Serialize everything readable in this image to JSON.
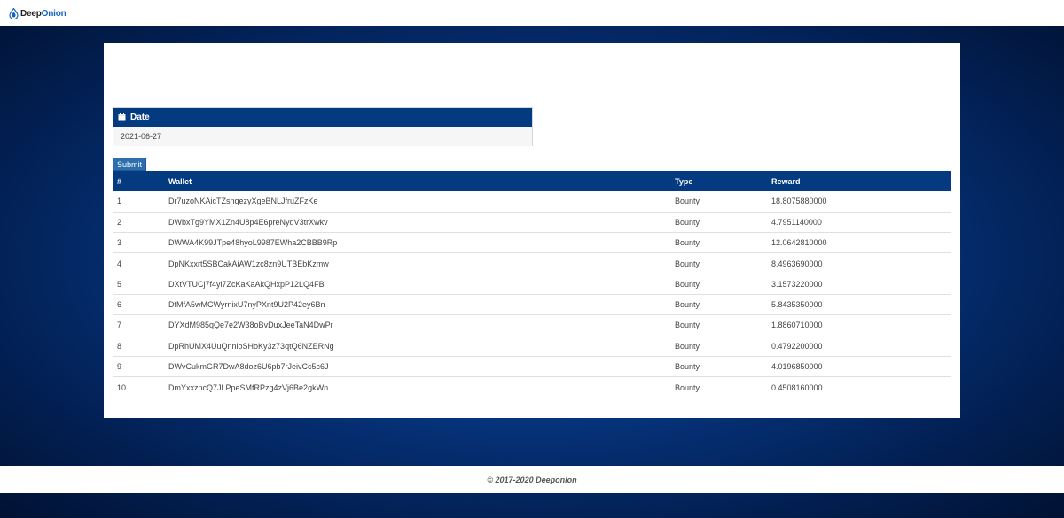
{
  "brand": {
    "name_part1": "Deep",
    "name_part2": "Onion"
  },
  "date_panel": {
    "label": "Date",
    "value": "2021-06-27"
  },
  "submit_label": "Submit",
  "table": {
    "headers": {
      "num": "#",
      "wallet": "Wallet",
      "type": "Type",
      "reward": "Reward"
    },
    "rows": [
      {
        "num": "1",
        "wallet": "Dr7uzoNKAicTZsnqezyXgeBNLJfruZFzKe",
        "type": "Bounty",
        "reward": "18.8075880000"
      },
      {
        "num": "2",
        "wallet": "DWbxTg9YMX1Zn4U8p4E6preNydV3trXwkv",
        "type": "Bounty",
        "reward": "4.7951140000"
      },
      {
        "num": "3",
        "wallet": "DWWA4K99JTpe48hyoL9987EWha2CBBB9Rp",
        "type": "Bounty",
        "reward": "12.0642810000"
      },
      {
        "num": "4",
        "wallet": "DpNKxxrt5SBCakAiAW1zc8zn9UTBEbKzmw",
        "type": "Bounty",
        "reward": "8.4963690000"
      },
      {
        "num": "5",
        "wallet": "DXtVTUCj7f4yi7ZcKaKaAkQHxpP12LQ4FB",
        "type": "Bounty",
        "reward": "3.1573220000"
      },
      {
        "num": "6",
        "wallet": "DfMfA5wMCWyrnixU7nyPXnt9U2P42ey6Bn",
        "type": "Bounty",
        "reward": "5.8435350000"
      },
      {
        "num": "7",
        "wallet": "DYXdM985qQe7e2W38oBvDuxJeeTaN4DwPr",
        "type": "Bounty",
        "reward": "1.8860710000"
      },
      {
        "num": "8",
        "wallet": "DpRhUMX4UuQnnioSHoKy3z73qtQ6NZERNg",
        "type": "Bounty",
        "reward": "0.4792200000"
      },
      {
        "num": "9",
        "wallet": "DWvCukmGR7DwA8doz6U6pb7rJeivCc5c6J",
        "type": "Bounty",
        "reward": "4.0196850000"
      },
      {
        "num": "10",
        "wallet": "DmYxxzncQ7JLPpeSMfRPzg4zVj6Be2gkWn",
        "type": "Bounty",
        "reward": "0.4508160000"
      }
    ]
  },
  "footer": {
    "copyright": "© 2017-2020 Deeponion"
  }
}
